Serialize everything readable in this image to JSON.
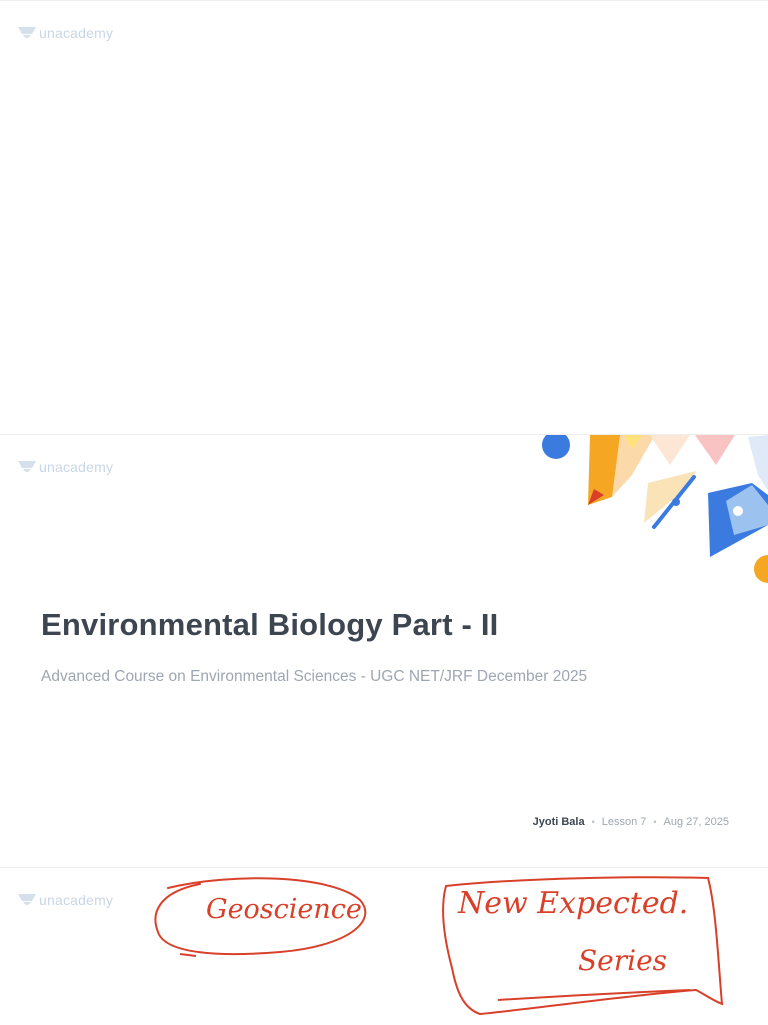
{
  "brand": {
    "logo_text": "unacademy"
  },
  "slide": {
    "title": "Environmental Biology Part - II",
    "subtitle": "Advanced Course on Environmental Sciences - UGC NET/JRF December 2025",
    "author": "Jyoti Bala",
    "separator": "•",
    "lesson": "Lesson 7",
    "date": "Aug 27, 2025"
  },
  "annotations": {
    "circle_note": "Geoscience",
    "box_note_line1": "New Expected.",
    "box_note_line2": "Series"
  },
  "colors": {
    "title": "#3d4550",
    "subtitle": "#9ea6b2",
    "logo": "#c9d6e6",
    "ink": "#d8402a",
    "accent_blue": "#3b7be0",
    "accent_orange": "#f5a623"
  }
}
